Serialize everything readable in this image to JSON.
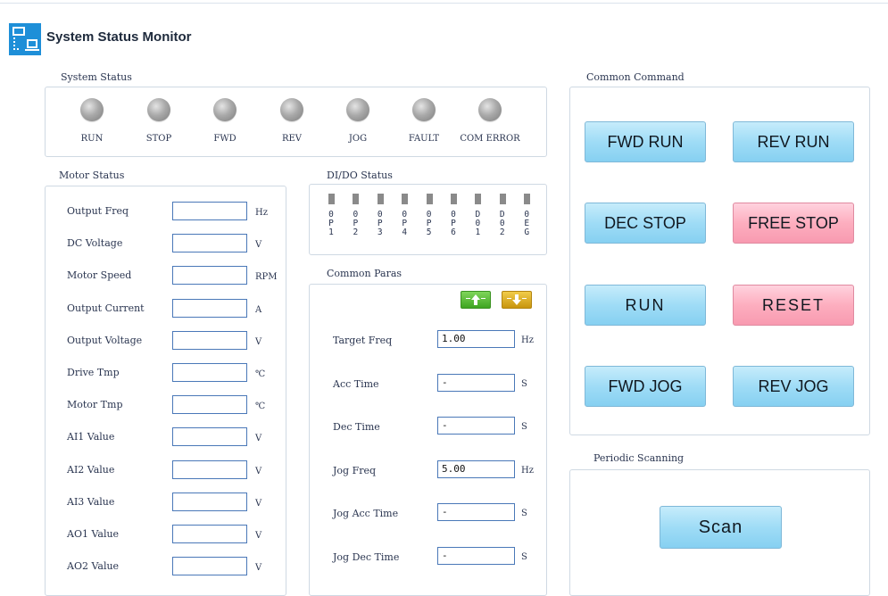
{
  "window": {
    "title": "System Status Monitor"
  },
  "colors": {
    "led_off": "#a9a9a9",
    "button_blue": "#9fdcf6",
    "button_red": "#fdaebf",
    "tool_green": "#5cbf3a",
    "tool_gold": "#d6a92a",
    "field_border": "#4a78b8"
  },
  "system_status": {
    "title": "System Status",
    "indicators": [
      {
        "label": "RUN",
        "state": "off"
      },
      {
        "label": "STOP",
        "state": "off"
      },
      {
        "label": "FWD",
        "state": "off"
      },
      {
        "label": "REV",
        "state": "off"
      },
      {
        "label": "JOG",
        "state": "off"
      },
      {
        "label": "FAULT",
        "state": "off"
      },
      {
        "label": "COM ERROR",
        "state": "off"
      }
    ]
  },
  "motor_status": {
    "title": "Motor Status",
    "rows": [
      {
        "label": "Output Freq",
        "value": "",
        "unit": "Hz"
      },
      {
        "label": "DC Voltage",
        "value": "",
        "unit": "V"
      },
      {
        "label": "Motor Speed",
        "value": "",
        "unit": "RPM"
      },
      {
        "label": "Output Current",
        "value": "",
        "unit": "A"
      },
      {
        "label": "Output Voltage",
        "value": "",
        "unit": "V"
      },
      {
        "label": "Drive Tmp",
        "value": "",
        "unit": "℃"
      },
      {
        "label": "Motor Tmp",
        "value": "",
        "unit": "℃"
      },
      {
        "label": "AI1 Value",
        "value": "",
        "unit": "V"
      },
      {
        "label": "AI2 Value",
        "value": "",
        "unit": "V"
      },
      {
        "label": "AI3 Value",
        "value": "",
        "unit": "V"
      },
      {
        "label": "AO1 Value",
        "value": "",
        "unit": "V"
      },
      {
        "label": "AO2 Value",
        "value": "",
        "unit": "V"
      }
    ]
  },
  "dido_status": {
    "title": "DI/DO Status",
    "channels": [
      {
        "c1": "0",
        "c2": "P",
        "c3": "1"
      },
      {
        "c1": "0",
        "c2": "P",
        "c3": "2"
      },
      {
        "c1": "0",
        "c2": "P",
        "c3": "3"
      },
      {
        "c1": "0",
        "c2": "P",
        "c3": "4"
      },
      {
        "c1": "0",
        "c2": "P",
        "c3": "5"
      },
      {
        "c1": "0",
        "c2": "P",
        "c3": "6"
      },
      {
        "c1": "D",
        "c2": "0",
        "c3": "1"
      },
      {
        "c1": "D",
        "c2": "0",
        "c3": "2"
      },
      {
        "c1": "0",
        "c2": "E",
        "c3": "G"
      }
    ]
  },
  "common_paras": {
    "title": "Common Paras",
    "tools": {
      "upload_icon": "upload-icon",
      "download_icon": "download-icon"
    },
    "rows": [
      {
        "label": "Target Freq",
        "value": "1.00",
        "unit": "Hz"
      },
      {
        "label": "Acc Time",
        "value": "-",
        "unit": "S"
      },
      {
        "label": "Dec Time",
        "value": "-",
        "unit": "S"
      },
      {
        "label": "Jog Freq",
        "value": "5.00",
        "unit": "Hz"
      },
      {
        "label": "Jog Acc Time",
        "value": "-",
        "unit": "S"
      },
      {
        "label": "Jog Dec Time",
        "value": "-",
        "unit": "S"
      }
    ]
  },
  "common_command": {
    "title": "Common Command",
    "buttons": [
      {
        "label": "FWD RUN",
        "style": "blue"
      },
      {
        "label": "REV RUN",
        "style": "blue"
      },
      {
        "label": "DEC STOP",
        "style": "blue"
      },
      {
        "label": "FREE STOP",
        "style": "red"
      },
      {
        "label": "RUN",
        "style": "blue"
      },
      {
        "label": "RESET",
        "style": "red"
      },
      {
        "label": "FWD JOG",
        "style": "blue"
      },
      {
        "label": "REV JOG",
        "style": "blue"
      }
    ]
  },
  "periodic_scanning": {
    "title": "Periodic Scanning",
    "scan_label": "Scan"
  }
}
